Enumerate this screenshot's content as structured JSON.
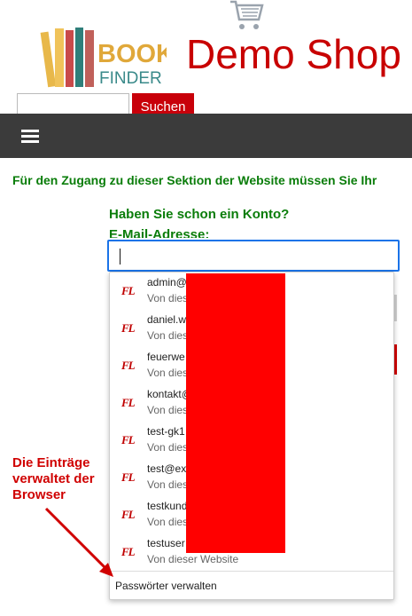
{
  "header": {
    "logo_line1": "BOOK",
    "logo_line2": "FINDER",
    "shop_title": "Demo Shop",
    "cart_icon": "shopping-cart-icon"
  },
  "search": {
    "value": "",
    "placeholder": "",
    "button_label": "Suchen"
  },
  "nav": {
    "menu_icon": "hamburger-menu-icon"
  },
  "main": {
    "notice": "Für den Zugang zu dieser Sektion der Website müssen Sie Ihr",
    "login_heading": "Haben Sie schon ein Konto?",
    "email_label": "E-Mail-Adresse:",
    "email_value": ""
  },
  "autofill": {
    "entries": [
      {
        "user": "admin@",
        "sub": "Von dies"
      },
      {
        "user": "daniel.w",
        "sub": "Von dies"
      },
      {
        "user": "feuerwe",
        "sub": "Von dies"
      },
      {
        "user": "kontakt@",
        "sub": "Von dies"
      },
      {
        "user": "test-gk1",
        "sub": "Von dies"
      },
      {
        "user": "test@ex",
        "sub": "Von dies"
      },
      {
        "user": "testkund",
        "sub": "Von dies"
      },
      {
        "user": "testuser",
        "sub": "Von dieser Website"
      }
    ],
    "manage_label": "Passwörter verwalten",
    "entry_icon_text": "FL"
  },
  "annotation": {
    "line1": "Die Einträge",
    "line2": "verwaltet der",
    "line3": "Browser",
    "color": "#d00000"
  },
  "colors": {
    "brand_red": "#c80000",
    "nav_bg": "#3b3b3b",
    "green_text": "#0a7d0a",
    "focus_blue": "#1a73e8"
  }
}
